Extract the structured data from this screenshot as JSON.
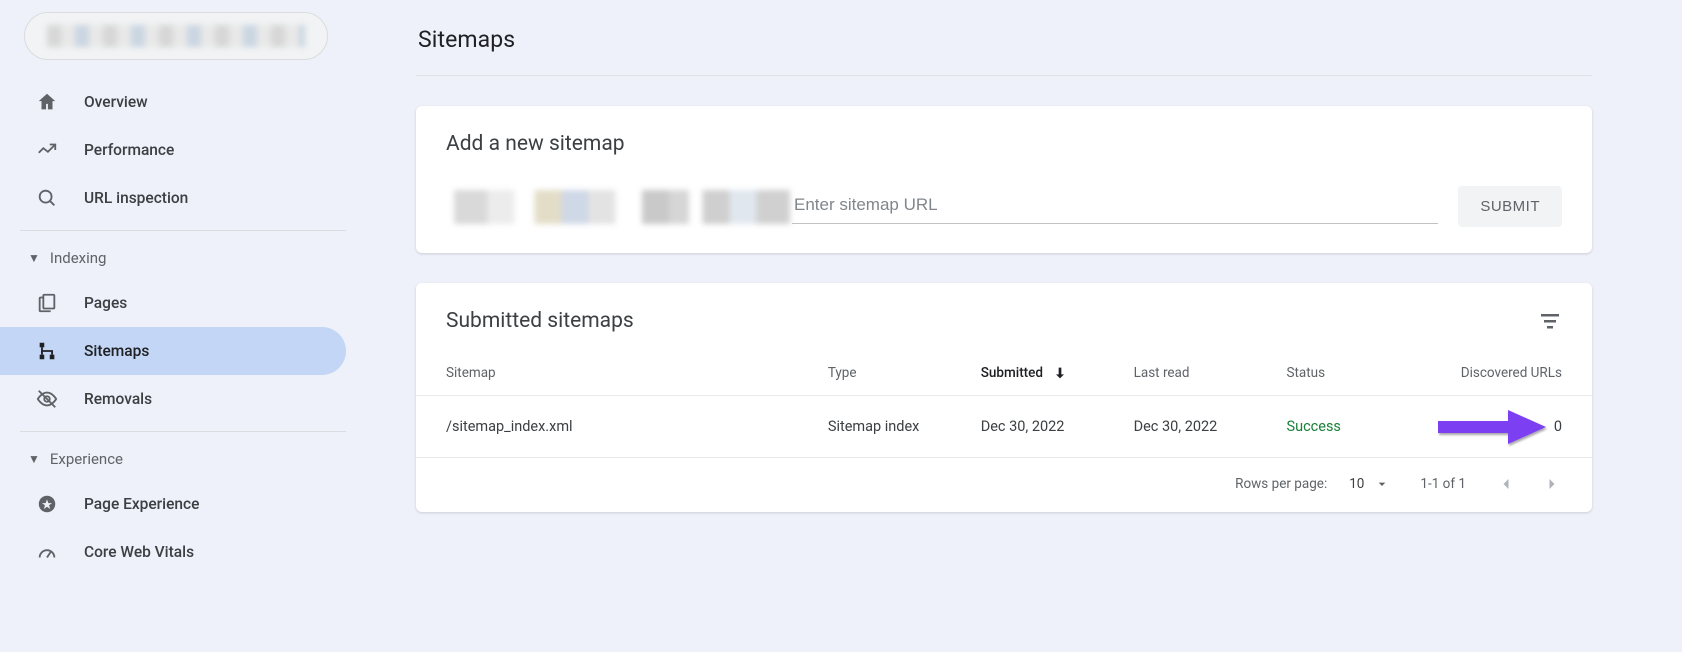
{
  "sidebar": {
    "items": [
      {
        "label": "Overview"
      },
      {
        "label": "Performance"
      },
      {
        "label": "URL inspection"
      }
    ],
    "section_indexing": "Indexing",
    "indexing_items": [
      {
        "label": "Pages"
      },
      {
        "label": "Sitemaps"
      },
      {
        "label": "Removals"
      }
    ],
    "section_experience": "Experience",
    "experience_items": [
      {
        "label": "Page Experience"
      },
      {
        "label": "Core Web Vitals"
      }
    ]
  },
  "page": {
    "title": "Sitemaps"
  },
  "add_card": {
    "heading": "Add a new sitemap",
    "placeholder": "Enter sitemap URL",
    "submit_label": "SUBMIT"
  },
  "submitted_card": {
    "heading": "Submitted sitemaps",
    "columns": {
      "sitemap": "Sitemap",
      "type": "Type",
      "submitted": "Submitted",
      "last_read": "Last read",
      "status": "Status",
      "discovered": "Discovered URLs"
    },
    "rows": [
      {
        "sitemap": "/sitemap_index.xml",
        "type": "Sitemap index",
        "submitted": "Dec 30, 2022",
        "last_read": "Dec 30, 2022",
        "status": "Success",
        "discovered": "0"
      }
    ],
    "footer": {
      "rows_per_page_label": "Rows per page:",
      "rows_per_page_value": "10",
      "range_text": "1-1 of 1"
    }
  }
}
